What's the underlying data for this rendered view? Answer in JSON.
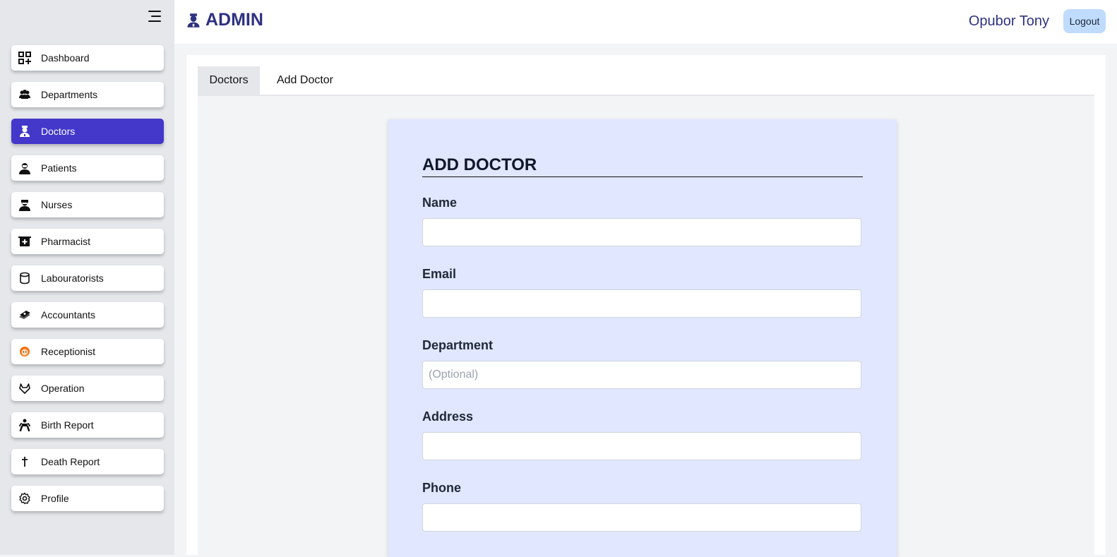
{
  "header": {
    "brand": "ADMIN",
    "username": "Opubor Tony",
    "logout_label": "Logout"
  },
  "sidebar": {
    "items": [
      {
        "label": "Dashboard",
        "icon": "dashboard-icon"
      },
      {
        "label": "Departments",
        "icon": "people-group-icon"
      },
      {
        "label": "Doctors",
        "icon": "doctor-icon",
        "active": true
      },
      {
        "label": "Patients",
        "icon": "patient-icon"
      },
      {
        "label": "Nurses",
        "icon": "nurse-icon"
      },
      {
        "label": "Pharmacist",
        "icon": "pharmacy-icon"
      },
      {
        "label": "Labouratorists",
        "icon": "database-icon"
      },
      {
        "label": "Accountants",
        "icon": "money-icon"
      },
      {
        "label": "Receptionist",
        "icon": "receptionist-icon"
      },
      {
        "label": "Operation",
        "icon": "operation-icon"
      },
      {
        "label": "Birth Report",
        "icon": "baby-icon"
      },
      {
        "label": "Death Report",
        "icon": "cross-icon"
      },
      {
        "label": "Profile",
        "icon": "gear-icon"
      }
    ]
  },
  "tabs": [
    {
      "label": "Doctors",
      "active": true
    },
    {
      "label": "Add Doctor",
      "active": false
    }
  ],
  "form": {
    "title": "ADD DOCTOR",
    "fields": [
      {
        "label": "Name",
        "value": "",
        "placeholder": ""
      },
      {
        "label": "Email",
        "value": "",
        "placeholder": ""
      },
      {
        "label": "Department",
        "value": "",
        "placeholder": "(Optional)"
      },
      {
        "label": "Address",
        "value": "",
        "placeholder": ""
      },
      {
        "label": "Phone",
        "value": "",
        "placeholder": ""
      }
    ]
  },
  "colors": {
    "accent": "#4338ca",
    "brand_text": "#2e3282",
    "form_bg": "#e0e7ff",
    "logout_bg": "#bfdbfe"
  }
}
